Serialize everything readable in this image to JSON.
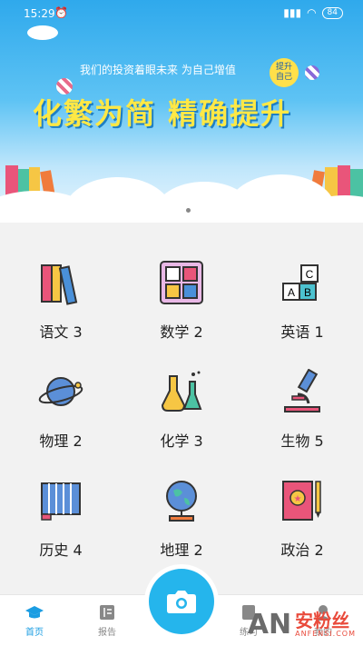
{
  "status_bar": {
    "time": "15:29",
    "battery": "84"
  },
  "banner": {
    "slogan": "我们的投资着眼未来 为自己增值",
    "badge_line1": "提升",
    "badge_line2": "自己",
    "headline": "化繁为简 精确提升"
  },
  "subjects": [
    {
      "label": "语文 3",
      "icon": "books-icon"
    },
    {
      "label": "数学 2",
      "icon": "calculator-icon"
    },
    {
      "label": "英语 1",
      "icon": "abc-blocks-icon"
    },
    {
      "label": "物理 2",
      "icon": "planet-icon"
    },
    {
      "label": "化学 3",
      "icon": "flask-icon"
    },
    {
      "label": "生物 5",
      "icon": "microscope-icon"
    },
    {
      "label": "历史 4",
      "icon": "scroll-icon"
    },
    {
      "label": "地理 2",
      "icon": "globe-icon"
    },
    {
      "label": "政治 2",
      "icon": "notebook-icon"
    }
  ],
  "tabbar": {
    "home": "首页",
    "report": "报告",
    "practice": "练习",
    "mine": "我的"
  },
  "watermark": {
    "brand": "AN",
    "cn": "安粉丝",
    "domain": "ANFENSI.COM"
  }
}
